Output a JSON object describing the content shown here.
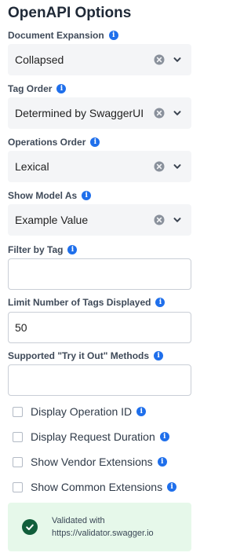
{
  "title": "OpenAPI Options",
  "document_expansion": {
    "label": "Document Expansion",
    "value": "Collapsed"
  },
  "tag_order": {
    "label": "Tag Order",
    "value": "Determined by SwaggerUI"
  },
  "operations_order": {
    "label": "Operations Order",
    "value": "Lexical"
  },
  "show_model_as": {
    "label": "Show Model As",
    "value": "Example Value"
  },
  "filter_by_tag": {
    "label": "Filter by Tag",
    "value": ""
  },
  "limit_tags": {
    "label": "Limit Number of Tags Displayed",
    "value": "50"
  },
  "try_it_out_methods": {
    "label": "Supported \"Try it Out\" Methods",
    "value": ""
  },
  "checkboxes": [
    {
      "label": "Display Operation ID",
      "checked": false
    },
    {
      "label": "Display Request Duration",
      "checked": false
    },
    {
      "label": "Show Vendor Extensions",
      "checked": false
    },
    {
      "label": "Show Common Extensions",
      "checked": false
    }
  ],
  "validation": {
    "line1": "Validated with",
    "line2": "https://validator.swagger.io"
  },
  "colors": {
    "info_icon": "#1f6feb",
    "validated_bg": "#e6f8ea",
    "validated_badge": "#115e3b"
  },
  "icons": {
    "info": "info-icon",
    "clear": "clear-icon",
    "chevron": "chevron-down-icon",
    "check": "check-icon"
  }
}
